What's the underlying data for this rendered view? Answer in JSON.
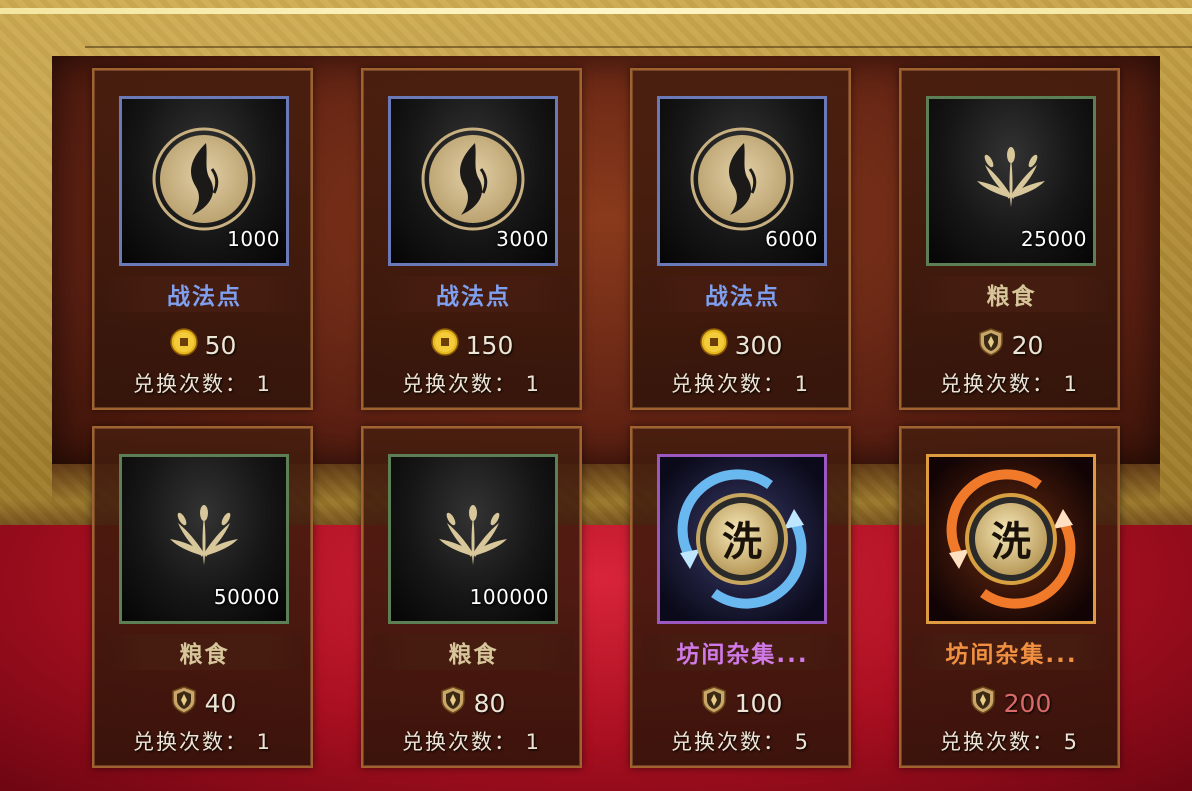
{
  "colors": {
    "name_blue": "#7f9ff0",
    "name_green": "#d6c69a",
    "name_purple": "#d07ae8",
    "name_orange": "#f09040",
    "price_red": "#d86a6a"
  },
  "count_label": "兑换次数：",
  "items": [
    {
      "name": "战法点",
      "qty": "1000",
      "icon": "tactic-point-icon",
      "currency": "copper-coin-icon",
      "price": "50",
      "count": "1",
      "rarity": "blue"
    },
    {
      "name": "战法点",
      "qty": "3000",
      "icon": "tactic-point-icon",
      "currency": "copper-coin-icon",
      "price": "150",
      "count": "1",
      "rarity": "blue"
    },
    {
      "name": "战法点",
      "qty": "6000",
      "icon": "tactic-point-icon",
      "currency": "copper-coin-icon",
      "price": "300",
      "count": "1",
      "rarity": "blue"
    },
    {
      "name": "粮食",
      "qty": "25000",
      "icon": "grain-icon",
      "currency": "shield-token-icon",
      "price": "20",
      "count": "1",
      "rarity": "green"
    },
    {
      "name": "粮食",
      "qty": "50000",
      "icon": "grain-icon",
      "currency": "shield-token-icon",
      "price": "40",
      "count": "1",
      "rarity": "green"
    },
    {
      "name": "粮食",
      "qty": "100000",
      "icon": "grain-icon",
      "currency": "shield-token-icon",
      "price": "80",
      "count": "1",
      "rarity": "green"
    },
    {
      "name": "坊间杂集...",
      "qty": "",
      "icon": "wash-purple-icon",
      "currency": "shield-token-icon",
      "price": "100",
      "count": "5",
      "rarity": "purple"
    },
    {
      "name": "坊间杂集...",
      "qty": "",
      "icon": "wash-orange-icon",
      "currency": "shield-token-icon",
      "price": "200",
      "count": "5",
      "rarity": "orange"
    }
  ]
}
